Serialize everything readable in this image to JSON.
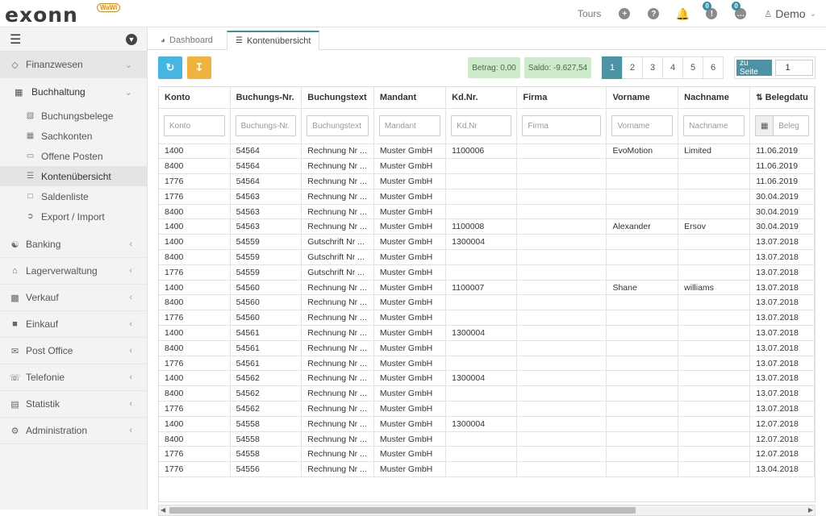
{
  "app": {
    "logo_text": "exonn",
    "logo_badge": "WaWi"
  },
  "topbar": {
    "tours_label": "Tours",
    "notification_badge_1": "0",
    "notification_badge_2": "0",
    "user_name": "Demo"
  },
  "sidebar": {
    "finanzwesen": "Finanzwesen",
    "buchhaltung": "Buchhaltung",
    "sub_items": [
      "Buchungsbelege",
      "Sachkonten",
      "Offene Posten",
      "Kontenübersicht",
      "Saldenliste",
      "Export / Import"
    ],
    "sections": [
      "Banking",
      "Lagerverwaltung",
      "Verkauf",
      "Einkauf",
      "Post Office",
      "Telefonie",
      "Statistik",
      "Administration"
    ]
  },
  "tabs": {
    "dashboard": "Dashboard",
    "kontenuebersicht": "Kontenübersicht"
  },
  "toolbar": {
    "betrag": "Betrag: 0,00",
    "saldo": "Saldo: -9.627,54",
    "pages": [
      "1",
      "2",
      "3",
      "4",
      "5",
      "6"
    ],
    "active_page": "1",
    "goto_label": "zu Seite",
    "goto_value": "1"
  },
  "table": {
    "columns": [
      "Konto",
      "Buchungs-Nr.",
      "Buchungstext",
      "Mandant",
      "Kd.Nr.",
      "Firma",
      "Vorname",
      "Nachname",
      "Belegdatu"
    ],
    "filter_placeholders": [
      "Konto",
      "Buchungs-Nr.",
      "Buchungstext",
      "Mandant",
      "Kd.Nr",
      "Firma",
      "Vorname",
      "Nachname",
      "Beleg"
    ],
    "rows": [
      [
        "1400",
        "54564",
        "Rechnung Nr ...",
        "Muster GmbH",
        "1100006",
        "",
        "EvoMotion",
        "Limited",
        "11.06.2019"
      ],
      [
        "8400",
        "54564",
        "Rechnung Nr ...",
        "Muster GmbH",
        "",
        "",
        "",
        "",
        "11.06.2019"
      ],
      [
        "1776",
        "54564",
        "Rechnung Nr ...",
        "Muster GmbH",
        "",
        "",
        "",
        "",
        "11.06.2019"
      ],
      [
        "1776",
        "54563",
        "Rechnung Nr ...",
        "Muster GmbH",
        "",
        "",
        "",
        "",
        "30.04.2019"
      ],
      [
        "8400",
        "54563",
        "Rechnung Nr ...",
        "Muster GmbH",
        "",
        "",
        "",
        "",
        "30.04.2019"
      ],
      [
        "1400",
        "54563",
        "Rechnung Nr ...",
        "Muster GmbH",
        "1100008",
        "",
        "Alexander",
        "Ersov",
        "30.04.2019"
      ],
      [
        "1400",
        "54559",
        "Gutschrift Nr ...",
        "Muster GmbH",
        "1300004",
        "",
        "",
        "",
        "13.07.2018"
      ],
      [
        "8400",
        "54559",
        "Gutschrift Nr ...",
        "Muster GmbH",
        "",
        "",
        "",
        "",
        "13.07.2018"
      ],
      [
        "1776",
        "54559",
        "Gutschrift Nr ...",
        "Muster GmbH",
        "",
        "",
        "",
        "",
        "13.07.2018"
      ],
      [
        "1400",
        "54560",
        "Rechnung Nr ...",
        "Muster GmbH",
        "1100007",
        "",
        "Shane",
        "williams",
        "13.07.2018"
      ],
      [
        "8400",
        "54560",
        "Rechnung Nr ...",
        "Muster GmbH",
        "",
        "",
        "",
        "",
        "13.07.2018"
      ],
      [
        "1776",
        "54560",
        "Rechnung Nr ...",
        "Muster GmbH",
        "",
        "",
        "",
        "",
        "13.07.2018"
      ],
      [
        "1400",
        "54561",
        "Rechnung Nr ...",
        "Muster GmbH",
        "1300004",
        "",
        "",
        "",
        "13.07.2018"
      ],
      [
        "8400",
        "54561",
        "Rechnung Nr ...",
        "Muster GmbH",
        "",
        "",
        "",
        "",
        "13.07.2018"
      ],
      [
        "1776",
        "54561",
        "Rechnung Nr ...",
        "Muster GmbH",
        "",
        "",
        "",
        "",
        "13.07.2018"
      ],
      [
        "1400",
        "54562",
        "Rechnung Nr ...",
        "Muster GmbH",
        "1300004",
        "",
        "",
        "",
        "13.07.2018"
      ],
      [
        "8400",
        "54562",
        "Rechnung Nr ...",
        "Muster GmbH",
        "",
        "",
        "",
        "",
        "13.07.2018"
      ],
      [
        "1776",
        "54562",
        "Rechnung Nr ...",
        "Muster GmbH",
        "",
        "",
        "",
        "",
        "13.07.2018"
      ],
      [
        "1400",
        "54558",
        "Rechnung Nr ...",
        "Muster GmbH",
        "1300004",
        "",
        "",
        "",
        "12.07.2018"
      ],
      [
        "8400",
        "54558",
        "Rechnung Nr ...",
        "Muster GmbH",
        "",
        "",
        "",
        "",
        "12.07.2018"
      ],
      [
        "1776",
        "54558",
        "Rechnung Nr ...",
        "Muster GmbH",
        "",
        "",
        "",
        "",
        "12.07.2018"
      ],
      [
        "1776",
        "54556",
        "Rechnung Nr ...",
        "Muster GmbH",
        "",
        "",
        "",
        "",
        "13.04.2018"
      ]
    ]
  },
  "colors": {
    "accent": "#4c94a5",
    "refresh": "#45b6e3",
    "download": "#f2b23e",
    "saldo_bg": "#cdeacb"
  }
}
